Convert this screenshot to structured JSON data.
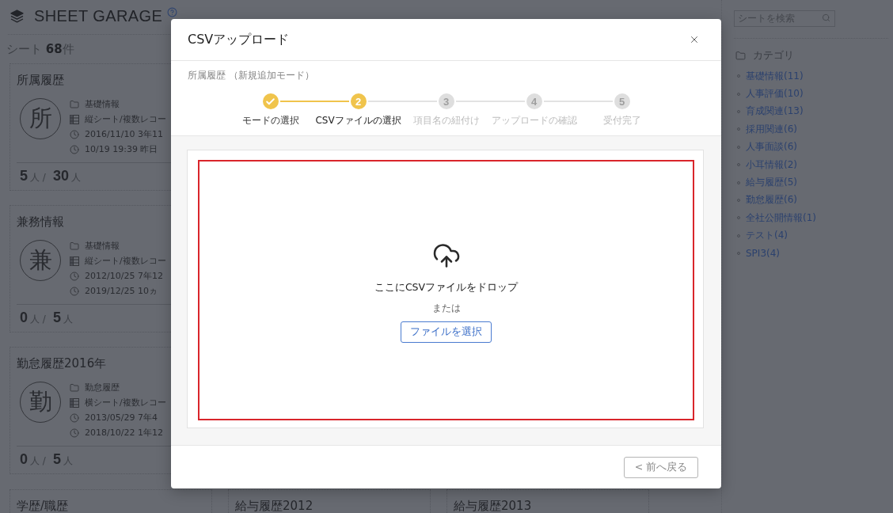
{
  "header": {
    "title": "SHEET GARAGE"
  },
  "sheet_count": "シート **68**件",
  "cards": [
    {
      "title": "所属履歴",
      "initial": "所",
      "meta": [
        {
          "kind": "category",
          "text": "基礎情報"
        },
        {
          "kind": "type",
          "text": "縦シート/複数レコー"
        },
        {
          "kind": "created",
          "text": "2016/11/10 3年11"
        },
        {
          "kind": "updated",
          "text": "10/19 19:39 昨日"
        }
      ],
      "members": "5",
      "members_unit": "人 /",
      "total": "30",
      "total_unit": "人"
    },
    {
      "title": "兼務情報",
      "initial": "兼",
      "meta": [
        {
          "kind": "category",
          "text": "基礎情報"
        },
        {
          "kind": "type",
          "text": "縦シート/複数レコー"
        },
        {
          "kind": "created",
          "text": "2012/10/25 7年12"
        },
        {
          "kind": "updated",
          "text": "2019/12/25 10ヵ"
        }
      ],
      "members": "0",
      "members_unit": "人 /",
      "total": "5",
      "total_unit": "人"
    },
    {
      "title": "勤怠履歴2016年",
      "initial": "勤",
      "meta": [
        {
          "kind": "category",
          "text": "勤怠履歴"
        },
        {
          "kind": "type",
          "text": "横シート/複数レコー"
        },
        {
          "kind": "created",
          "text": "2013/05/29 7年4"
        },
        {
          "kind": "updated",
          "text": "2018/10/22 1年12"
        }
      ],
      "members": "0",
      "members_unit": "人 /",
      "total": "5",
      "total_unit": "人"
    }
  ],
  "bottom_cards": [
    {
      "title": "学歴/職歴"
    },
    {
      "title": "給与履歴2012"
    },
    {
      "title": "給与履歴2013"
    }
  ],
  "sidebar": {
    "search": {
      "placeholder": "シートを検索"
    },
    "category_heading": "カテゴリ",
    "categories": [
      "基礎情報(11)",
      "人事評価(10)",
      "育成関連(13)",
      "採用関連(6)",
      "人事面談(6)",
      "小耳情報(2)",
      "給与履歴(5)",
      "勤怠履歴(6)",
      "全社公開情報(1)",
      "テスト(4)",
      "SPI3(4)"
    ]
  },
  "modal": {
    "title": "CSVアップロード",
    "subtitle": "所属履歴 （新規追加モード）",
    "steps": [
      {
        "label": "モードの選択",
        "done": true,
        "current": false
      },
      {
        "number": "2",
        "label": "CSVファイルの選択",
        "done": false,
        "current": true
      },
      {
        "number": "3",
        "label": "項目名の紐付け",
        "done": false,
        "current": false
      },
      {
        "number": "4",
        "label": "アップロードの確認",
        "done": false,
        "current": false
      },
      {
        "number": "5",
        "label": "受付完了",
        "done": false,
        "current": false
      }
    ],
    "dropzone": {
      "message": "ここにCSVファイルをドロップ",
      "separator": "または",
      "button": "ファイルを選択"
    },
    "footer": {
      "back_button": "< 前へ戻る"
    }
  }
}
